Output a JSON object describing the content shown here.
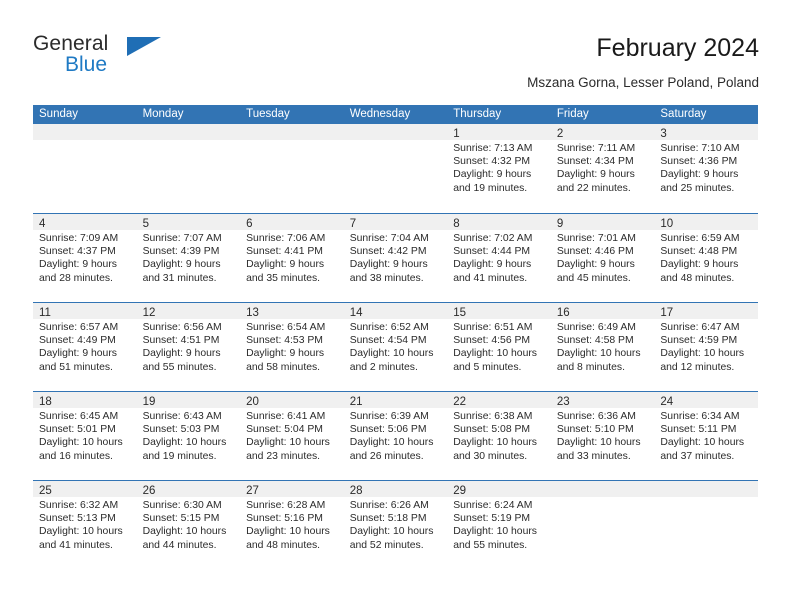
{
  "brand": {
    "name_part1": "General",
    "name_part2": "Blue",
    "triangle_color": "#1f6eb5",
    "blue_color": "#1f7ac4"
  },
  "header": {
    "title": "February 2024",
    "location": "Mszana Gorna, Lesser Poland, Poland"
  },
  "theme": {
    "header_blue": "#3274b4",
    "day_band_gray": "#f0f0f0",
    "text": "#2b2b2b"
  },
  "weekdays": [
    "Sunday",
    "Monday",
    "Tuesday",
    "Wednesday",
    "Thursday",
    "Friday",
    "Saturday"
  ],
  "weeks": [
    [
      {
        "day": "",
        "empty": true
      },
      {
        "day": "",
        "empty": true
      },
      {
        "day": "",
        "empty": true
      },
      {
        "day": "",
        "empty": true
      },
      {
        "day": "1",
        "sunrise": "Sunrise: 7:13 AM",
        "sunset": "Sunset: 4:32 PM",
        "daylight_line1": "Daylight: 9 hours",
        "daylight_line2": "and 19 minutes."
      },
      {
        "day": "2",
        "sunrise": "Sunrise: 7:11 AM",
        "sunset": "Sunset: 4:34 PM",
        "daylight_line1": "Daylight: 9 hours",
        "daylight_line2": "and 22 minutes."
      },
      {
        "day": "3",
        "sunrise": "Sunrise: 7:10 AM",
        "sunset": "Sunset: 4:36 PM",
        "daylight_line1": "Daylight: 9 hours",
        "daylight_line2": "and 25 minutes."
      }
    ],
    [
      {
        "day": "4",
        "sunrise": "Sunrise: 7:09 AM",
        "sunset": "Sunset: 4:37 PM",
        "daylight_line1": "Daylight: 9 hours",
        "daylight_line2": "and 28 minutes."
      },
      {
        "day": "5",
        "sunrise": "Sunrise: 7:07 AM",
        "sunset": "Sunset: 4:39 PM",
        "daylight_line1": "Daylight: 9 hours",
        "daylight_line2": "and 31 minutes."
      },
      {
        "day": "6",
        "sunrise": "Sunrise: 7:06 AM",
        "sunset": "Sunset: 4:41 PM",
        "daylight_line1": "Daylight: 9 hours",
        "daylight_line2": "and 35 minutes."
      },
      {
        "day": "7",
        "sunrise": "Sunrise: 7:04 AM",
        "sunset": "Sunset: 4:42 PM",
        "daylight_line1": "Daylight: 9 hours",
        "daylight_line2": "and 38 minutes."
      },
      {
        "day": "8",
        "sunrise": "Sunrise: 7:02 AM",
        "sunset": "Sunset: 4:44 PM",
        "daylight_line1": "Daylight: 9 hours",
        "daylight_line2": "and 41 minutes."
      },
      {
        "day": "9",
        "sunrise": "Sunrise: 7:01 AM",
        "sunset": "Sunset: 4:46 PM",
        "daylight_line1": "Daylight: 9 hours",
        "daylight_line2": "and 45 minutes."
      },
      {
        "day": "10",
        "sunrise": "Sunrise: 6:59 AM",
        "sunset": "Sunset: 4:48 PM",
        "daylight_line1": "Daylight: 9 hours",
        "daylight_line2": "and 48 minutes."
      }
    ],
    [
      {
        "day": "11",
        "sunrise": "Sunrise: 6:57 AM",
        "sunset": "Sunset: 4:49 PM",
        "daylight_line1": "Daylight: 9 hours",
        "daylight_line2": "and 51 minutes."
      },
      {
        "day": "12",
        "sunrise": "Sunrise: 6:56 AM",
        "sunset": "Sunset: 4:51 PM",
        "daylight_line1": "Daylight: 9 hours",
        "daylight_line2": "and 55 minutes."
      },
      {
        "day": "13",
        "sunrise": "Sunrise: 6:54 AM",
        "sunset": "Sunset: 4:53 PM",
        "daylight_line1": "Daylight: 9 hours",
        "daylight_line2": "and 58 minutes."
      },
      {
        "day": "14",
        "sunrise": "Sunrise: 6:52 AM",
        "sunset": "Sunset: 4:54 PM",
        "daylight_line1": "Daylight: 10 hours",
        "daylight_line2": "and 2 minutes."
      },
      {
        "day": "15",
        "sunrise": "Sunrise: 6:51 AM",
        "sunset": "Sunset: 4:56 PM",
        "daylight_line1": "Daylight: 10 hours",
        "daylight_line2": "and 5 minutes."
      },
      {
        "day": "16",
        "sunrise": "Sunrise: 6:49 AM",
        "sunset": "Sunset: 4:58 PM",
        "daylight_line1": "Daylight: 10 hours",
        "daylight_line2": "and 8 minutes."
      },
      {
        "day": "17",
        "sunrise": "Sunrise: 6:47 AM",
        "sunset": "Sunset: 4:59 PM",
        "daylight_line1": "Daylight: 10 hours",
        "daylight_line2": "and 12 minutes."
      }
    ],
    [
      {
        "day": "18",
        "sunrise": "Sunrise: 6:45 AM",
        "sunset": "Sunset: 5:01 PM",
        "daylight_line1": "Daylight: 10 hours",
        "daylight_line2": "and 16 minutes."
      },
      {
        "day": "19",
        "sunrise": "Sunrise: 6:43 AM",
        "sunset": "Sunset: 5:03 PM",
        "daylight_line1": "Daylight: 10 hours",
        "daylight_line2": "and 19 minutes."
      },
      {
        "day": "20",
        "sunrise": "Sunrise: 6:41 AM",
        "sunset": "Sunset: 5:04 PM",
        "daylight_line1": "Daylight: 10 hours",
        "daylight_line2": "and 23 minutes."
      },
      {
        "day": "21",
        "sunrise": "Sunrise: 6:39 AM",
        "sunset": "Sunset: 5:06 PM",
        "daylight_line1": "Daylight: 10 hours",
        "daylight_line2": "and 26 minutes."
      },
      {
        "day": "22",
        "sunrise": "Sunrise: 6:38 AM",
        "sunset": "Sunset: 5:08 PM",
        "daylight_line1": "Daylight: 10 hours",
        "daylight_line2": "and 30 minutes."
      },
      {
        "day": "23",
        "sunrise": "Sunrise: 6:36 AM",
        "sunset": "Sunset: 5:10 PM",
        "daylight_line1": "Daylight: 10 hours",
        "daylight_line2": "and 33 minutes."
      },
      {
        "day": "24",
        "sunrise": "Sunrise: 6:34 AM",
        "sunset": "Sunset: 5:11 PM",
        "daylight_line1": "Daylight: 10 hours",
        "daylight_line2": "and 37 minutes."
      }
    ],
    [
      {
        "day": "25",
        "sunrise": "Sunrise: 6:32 AM",
        "sunset": "Sunset: 5:13 PM",
        "daylight_line1": "Daylight: 10 hours",
        "daylight_line2": "and 41 minutes."
      },
      {
        "day": "26",
        "sunrise": "Sunrise: 6:30 AM",
        "sunset": "Sunset: 5:15 PM",
        "daylight_line1": "Daylight: 10 hours",
        "daylight_line2": "and 44 minutes."
      },
      {
        "day": "27",
        "sunrise": "Sunrise: 6:28 AM",
        "sunset": "Sunset: 5:16 PM",
        "daylight_line1": "Daylight: 10 hours",
        "daylight_line2": "and 48 minutes."
      },
      {
        "day": "28",
        "sunrise": "Sunrise: 6:26 AM",
        "sunset": "Sunset: 5:18 PM",
        "daylight_line1": "Daylight: 10 hours",
        "daylight_line2": "and 52 minutes."
      },
      {
        "day": "29",
        "sunrise": "Sunrise: 6:24 AM",
        "sunset": "Sunset: 5:19 PM",
        "daylight_line1": "Daylight: 10 hours",
        "daylight_line2": "and 55 minutes."
      },
      {
        "day": "",
        "empty": true
      },
      {
        "day": "",
        "empty": true
      }
    ]
  ]
}
